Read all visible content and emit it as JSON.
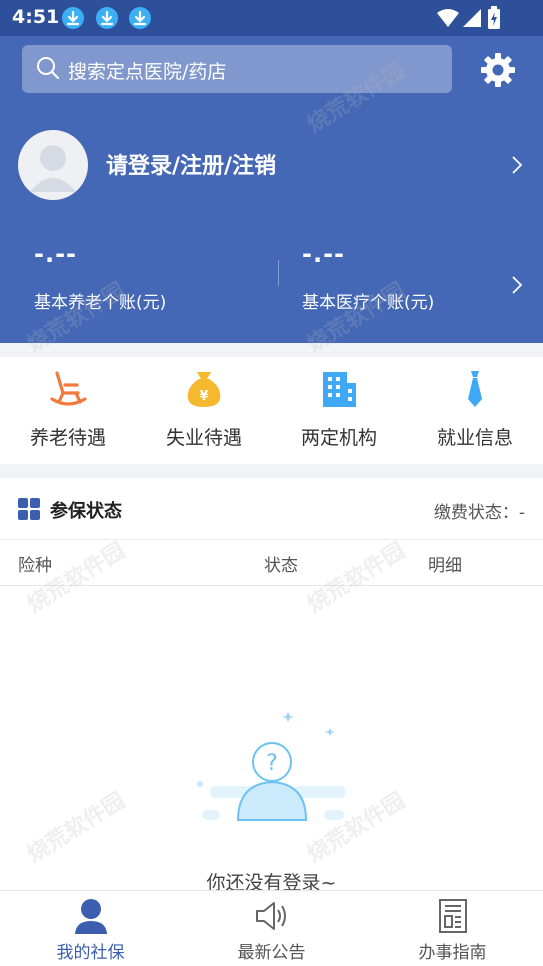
{
  "status_bar": {
    "time": "4:51",
    "icons": [
      "download-icon",
      "download-icon",
      "download-icon",
      "wifi-icon",
      "signal-icon",
      "battery-icon"
    ]
  },
  "search": {
    "placeholder": "搜索定点医院/药店",
    "settings_icon": "gear-icon"
  },
  "profile": {
    "login_text": "请登录/注册/注销"
  },
  "accounts": [
    {
      "value": "-.--",
      "label": "基本养老个账(元)"
    },
    {
      "value": "-.--",
      "label": "基本医疗个账(元)"
    }
  ],
  "services": [
    {
      "label": "养老待遇",
      "icon": "rocking-chair-icon",
      "color": "#f07a3c"
    },
    {
      "label": "失业待遇",
      "icon": "money-bag-icon",
      "color": "#f5b82e"
    },
    {
      "label": "两定机构",
      "icon": "building-icon",
      "color": "#3fa9f5"
    },
    {
      "label": "就业信息",
      "icon": "tie-icon",
      "color": "#3fa9f5"
    }
  ],
  "insurance_status": {
    "title": "参保状态",
    "pay_status": "缴费状态：-",
    "columns": [
      "险种",
      "状态",
      "明细"
    ],
    "empty_text": "你还没有登录~"
  },
  "watermark": "烧荒软件园",
  "bottom_nav": [
    {
      "label": "我的社保",
      "icon": "person-icon",
      "active": true
    },
    {
      "label": "最新公告",
      "icon": "speaker-icon",
      "active": false
    },
    {
      "label": "办事指南",
      "icon": "newspaper-icon",
      "active": false
    }
  ],
  "colors": {
    "header": "#4468b5",
    "status_bar": "#2e4f9a",
    "active_nav": "#3b5fae",
    "inactive_nav": "#555555"
  }
}
